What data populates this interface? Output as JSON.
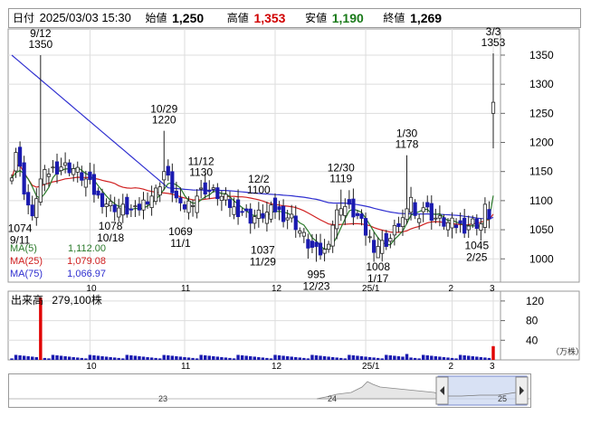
{
  "header": {
    "date_label": "日付",
    "datetime": "2025/03/03 15:30",
    "open_label": "始値",
    "open": "1,250",
    "high_label": "高値",
    "high": "1,353",
    "low_label": "安値",
    "low": "1,190",
    "close_label": "終値",
    "close": "1,269"
  },
  "colors": {
    "up": "#ffffff",
    "down": "#1a1ab0",
    "ma5": "#2b7a2b",
    "ma25": "#d02020",
    "ma75": "#3030d0",
    "volume": "#1a1ab0",
    "volume_last": "#e00000"
  },
  "legend": [
    {
      "name": "MA(5)",
      "value": "1,112.00",
      "color": "#2b7a2b"
    },
    {
      "name": "MA(25)",
      "value": "1,079.08",
      "color": "#d02020"
    },
    {
      "name": "MA(75)",
      "value": "1,066.97",
      "color": "#3030d0"
    }
  ],
  "volume_panel": {
    "title": "出来高",
    "value": "279,100株",
    "unit": "（万株）",
    "ticks": [
      "120",
      "80",
      "40"
    ]
  },
  "navigator": {
    "labels": [
      "23",
      "24",
      "25"
    ],
    "left_arrow_icon": "chevron-left-icon",
    "right_arrow_icon": "chevron-right-icon"
  },
  "chart_data": {
    "type": "candlestick",
    "y_ticks": [
      1000,
      1050,
      1100,
      1150,
      1200,
      1250,
      1300,
      1350
    ],
    "ylim": [
      960,
      1395
    ],
    "x_labels": [
      "10",
      "11",
      "12",
      "25/1",
      "2",
      "3"
    ],
    "annotations": [
      {
        "date": "9/12",
        "value": "1350"
      },
      {
        "date": "9/11",
        "value": "1074"
      },
      {
        "date": "10/18",
        "value": "1078"
      },
      {
        "date": "10/29",
        "value": "1220"
      },
      {
        "date": "11/1",
        "value": "1069"
      },
      {
        "date": "11/12",
        "value": "1130"
      },
      {
        "date": "11/29",
        "value": "1037"
      },
      {
        "date": "12/2",
        "value": "1100"
      },
      {
        "date": "12/23",
        "value": "995"
      },
      {
        "date": "12/30",
        "value": "1119"
      },
      {
        "date": "1/17",
        "value": "1008"
      },
      {
        "date": "1/30",
        "value": "1178"
      },
      {
        "date": "2/25",
        "value": "1045"
      },
      {
        "date": "3/3",
        "value": "1353"
      }
    ],
    "legend": [
      "MA(5)",
      "MA(25)",
      "MA(75)"
    ],
    "grid": true
  }
}
